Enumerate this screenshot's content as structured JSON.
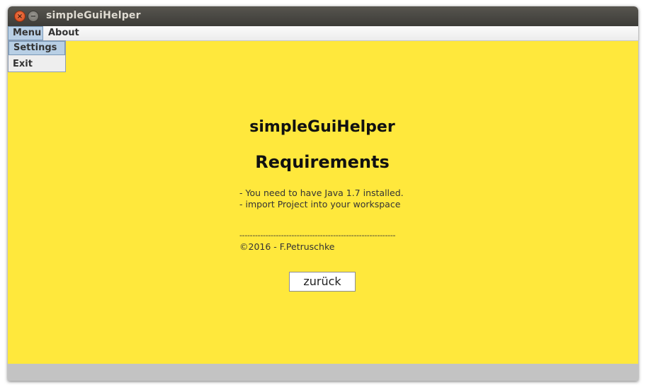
{
  "window": {
    "title": "simpleGuiHelper",
    "close_glyph": "×",
    "minimize_glyph": "−"
  },
  "menubar": {
    "items": [
      "Menu",
      "About"
    ]
  },
  "dropdown": {
    "items": [
      "Settings",
      "Exit"
    ]
  },
  "main": {
    "app_name": "simpleGuiHelper",
    "section_title": "Requirements",
    "requirements": [
      "- You need to have Java 1.7 installed.",
      "- import Project into your workspace"
    ],
    "separator": "------------------------------------------------------------",
    "copyright": "©2016 - F.Petruschke",
    "back_button": "zurück"
  },
  "colors": {
    "content_background": "#ffe83c",
    "titlebar": "#3d3c38",
    "menu_highlight": "#b8cfe5"
  }
}
